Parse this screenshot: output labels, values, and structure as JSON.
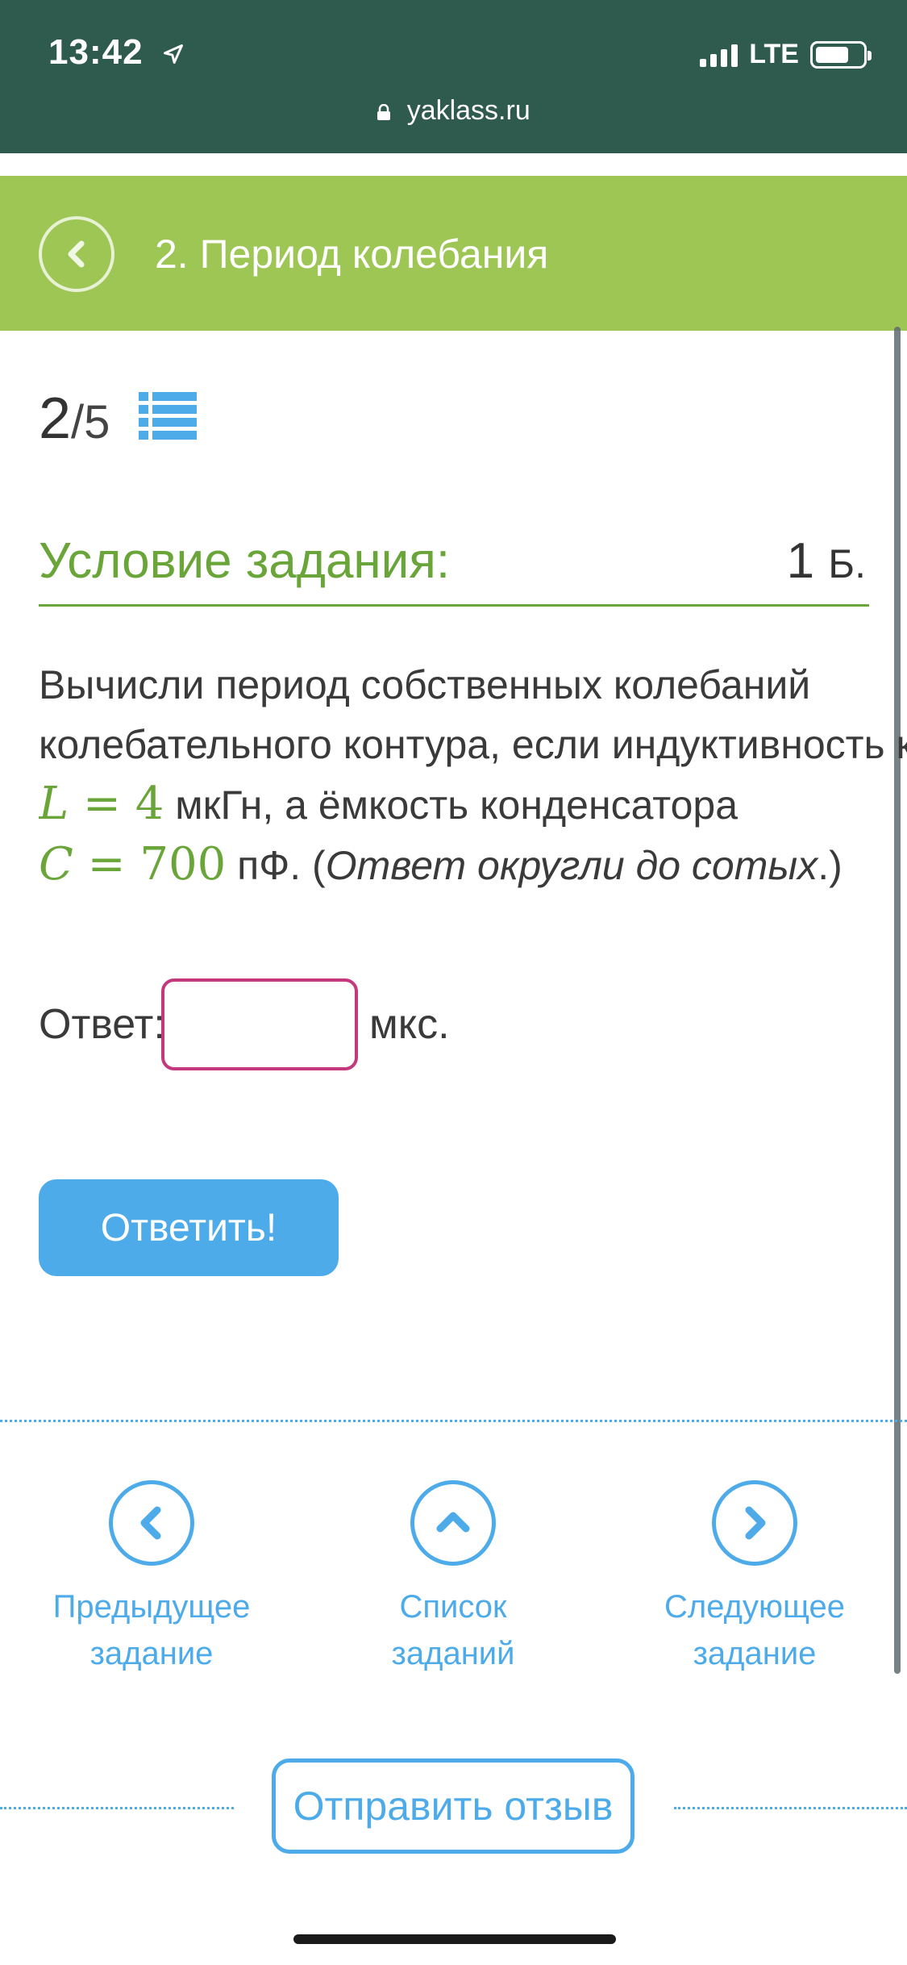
{
  "status": {
    "time": "13:42",
    "network": "LTE"
  },
  "browser": {
    "url": "yaklass.ru"
  },
  "header": {
    "title": "2. Период колебания"
  },
  "progress": {
    "current": "2",
    "total": "/5"
  },
  "task": {
    "heading": "Условие задания:",
    "points": "1",
    "points_unit": "Б.",
    "line1": "Вычисли период собственных колебаний",
    "line2": "колебательного контура, если индуктивность кат",
    "L_var": "L",
    "L_eq": " = 4",
    "L_rest": " мкГн, а ёмкость конденсатора",
    "C_var": "C",
    "C_eq": " = 700",
    "C_unit": " пФ. (",
    "hint": "Ответ округли до сотых",
    "hint_end": ".)"
  },
  "answer": {
    "label": "Ответ:",
    "value": "",
    "unit": "мкс."
  },
  "submit": {
    "label": "Ответить!"
  },
  "nav": {
    "prev_line1": "Предыдущее",
    "prev_line2": "задание",
    "list_line1": "Список",
    "list_line2": "заданий",
    "next_line1": "Следующее",
    "next_line2": "задание"
  },
  "feedback": {
    "label": "Отправить отзыв"
  },
  "colors": {
    "status_bar": "#2f5a4e",
    "header_green": "#9ec655",
    "heading_green": "#6aa539",
    "accent_blue": "#4dabe9",
    "input_border": "#c4387e"
  },
  "icons": {
    "location": "location-arrow-icon",
    "lock": "lock-icon",
    "back": "chevron-left-icon",
    "list": "list-icon",
    "prev": "chevron-left-icon",
    "up": "chevron-up-icon",
    "next": "chevron-right-icon"
  }
}
